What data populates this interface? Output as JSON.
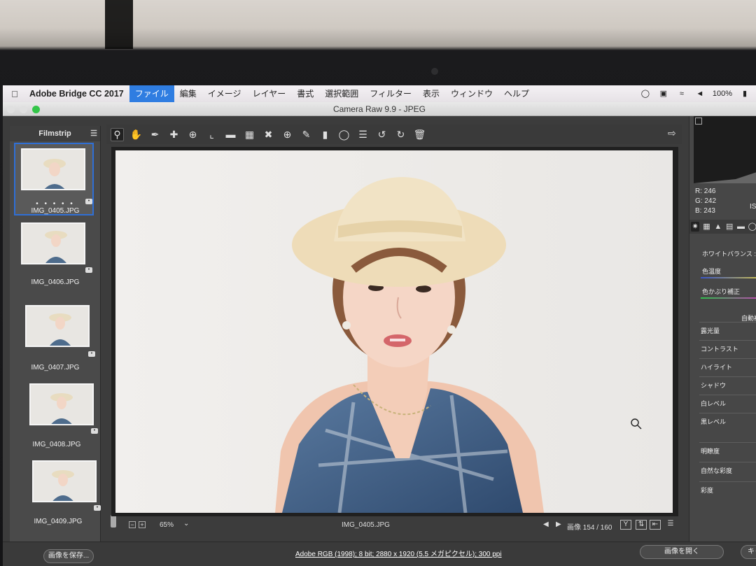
{
  "menubar": {
    "app_name": "Adobe Bridge CC 2017",
    "menus": [
      "ファイル",
      "編集",
      "イメージ",
      "レイヤー",
      "書式",
      "選択範囲",
      "フィルター",
      "表示",
      "ウィンドウ",
      "ヘルプ"
    ],
    "battery": "100%"
  },
  "window": {
    "title": "Camera Raw 9.9  -  JPEG"
  },
  "filmstrip": {
    "title": "Filmstrip",
    "items": [
      {
        "name": "IMG_0405.JPG",
        "rating": "• • • • •"
      },
      {
        "name": "IMG_0406.JPG"
      },
      {
        "name": "IMG_0407.JPG"
      },
      {
        "name": "IMG_0408.JPG"
      },
      {
        "name": "IMG_0409.JPG"
      }
    ]
  },
  "bottombar": {
    "zoom": "65%",
    "filename": "IMG_0405.JPG",
    "image_count": "画像 154 / 160",
    "y_label": "Y"
  },
  "rightpanel": {
    "rgb": {
      "r": "R:  246",
      "g": "G:  242",
      "b": "B:  243"
    },
    "iso": "IS",
    "white_balance": "ホワイトバランス :",
    "auto": "自動補",
    "params": [
      "色温度",
      "色かぶり補正",
      "露光量",
      "コントラスト",
      "ハイライト",
      "シャドウ",
      "白レベル",
      "黒レベル",
      "明瞭度",
      "自然な彩度",
      "彩度"
    ]
  },
  "footer": {
    "save_button": "画像を保存...",
    "info": "Adobe RGB (1998); 8 bit; 2880 x 1920 (5.5 メガピクセル); 300 ppi",
    "open_button": "画像を開く",
    "cancel_button": "キャ"
  },
  "colors": {
    "accent": "#2f7de1",
    "panel": "#474747",
    "canvas": "#202020"
  }
}
